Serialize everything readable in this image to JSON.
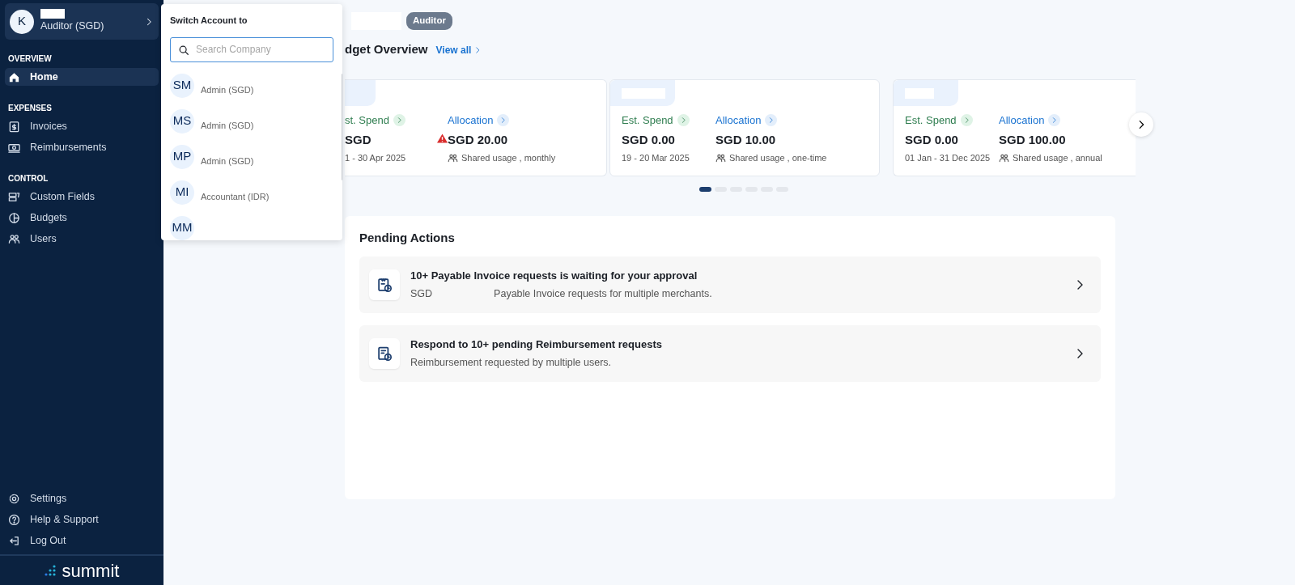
{
  "sidebar": {
    "account": {
      "initial": "K",
      "role": "Auditor (SGD)"
    },
    "sections": [
      {
        "heading": "OVERVIEW",
        "items": [
          {
            "label": "Home",
            "selected": true
          }
        ]
      },
      {
        "heading": "EXPENSES",
        "items": [
          {
            "label": "Invoices",
            "selected": false
          },
          {
            "label": "Reimbursements",
            "selected": false
          }
        ]
      },
      {
        "heading": "CONTROL",
        "items": [
          {
            "label": "Custom Fields",
            "selected": false
          },
          {
            "label": "Budgets",
            "selected": false
          },
          {
            "label": "Users",
            "selected": false
          }
        ]
      }
    ],
    "footer_items": [
      {
        "label": "Settings"
      },
      {
        "label": "Help & Support"
      },
      {
        "label": "Log Out"
      }
    ],
    "logo": "summit"
  },
  "switcher": {
    "title": "Switch Account to",
    "search": {
      "placeholder": "Search Company"
    },
    "accounts": [
      {
        "initials": "SM",
        "role": "Admin (SGD)"
      },
      {
        "initials": "MS",
        "role": "Admin (SGD)"
      },
      {
        "initials": "MP",
        "role": "Admin (SGD)"
      },
      {
        "initials": "MI",
        "role": "Accountant (IDR)"
      },
      {
        "initials": "MM"
      }
    ]
  },
  "header": {
    "badge": "Auditor"
  },
  "budget": {
    "title": "dget Overview",
    "link": "View all",
    "cards": [
      {
        "spend_label": "st. Spend",
        "spend": "SGD",
        "period": "1 - 30 Apr 2025",
        "warning": true,
        "allocation_label": "Allocation",
        "allocation": "SGD 20.00",
        "usage": "Shared usage , monthly"
      },
      {
        "spend_label": "Est. Spend",
        "spend": "SGD 0.00",
        "period": "19 - 20 Mar 2025",
        "warning": false,
        "allocation_label": "Allocation",
        "allocation": "SGD 10.00",
        "usage": "Shared usage , one-time"
      },
      {
        "spend_label": "Est. Spend",
        "spend": "SGD 0.00",
        "period": "01 Jan - 31 Dec 2025",
        "warning": false,
        "allocation_label": "Allocation",
        "allocation": "SGD 100.00",
        "usage": "Shared usage , annual"
      }
    ],
    "dots": [
      {
        "selected": true
      },
      {
        "selected": false
      },
      {
        "selected": false
      },
      {
        "selected": false
      },
      {
        "selected": false
      },
      {
        "selected": false
      }
    ]
  },
  "pending": {
    "title": "Pending Actions",
    "items": [
      {
        "title": "10+ Payable Invoice requests is waiting for your approval",
        "subtitle_parts": [
          "SGD",
          "Payable Invoice requests for multiple merchants."
        ]
      },
      {
        "title": "Respond to 10+ pending Reimbursement requests",
        "subtitle_parts": [
          "Reimbursement requested by multiple users."
        ]
      }
    ]
  }
}
